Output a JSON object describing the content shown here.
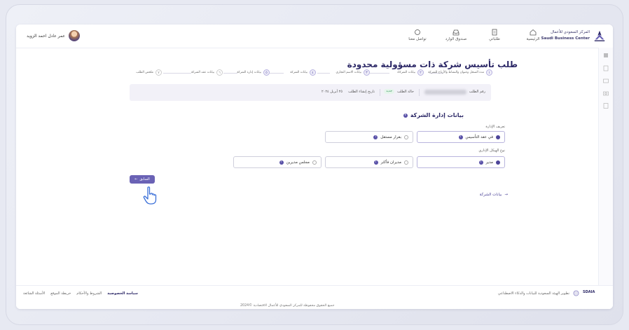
{
  "header": {
    "logo_ar": "المركز السعودي للأعمال",
    "logo_en": "Saudi Business Center",
    "nav": [
      {
        "label": "الرئيسية",
        "icon": "home-icon"
      },
      {
        "label": "طلباتي",
        "icon": "document-icon"
      },
      {
        "label": "صندوق الوارد",
        "icon": "inbox-icon"
      },
      {
        "label": "تواصل معنا",
        "icon": "chat-icon"
      }
    ],
    "user_name": "عمر عادل احمد الزويد"
  },
  "page_title": "طلب تأسيس شركة ذات مسؤولية محدودة",
  "steps": [
    {
      "num": "١",
      "label": "مدة السجل وعنوان والنشاط والأرباح للشركة",
      "state": "done"
    },
    {
      "num": "٢",
      "label": "بيانات الشركاء",
      "state": "done"
    },
    {
      "num": "٣",
      "label": "بيانات الاسم التجاري",
      "state": "done"
    },
    {
      "num": "٤",
      "label": "بيانات الشركة",
      "state": "done"
    },
    {
      "num": "٥",
      "label": "بيانات إدارة الشركة",
      "state": "done"
    },
    {
      "num": "٦",
      "label": "بيانات عقد الشركة",
      "state": "todo"
    },
    {
      "num": "٧",
      "label": "ملخص الطلب",
      "state": "todo"
    }
  ],
  "info_bar": {
    "request_number_label": "رقم الطلب",
    "status_label": "حالة الطلب",
    "status_value": "جديد",
    "created_label": "تاريخ إنشاء الطلب",
    "created_value": "٢٥ أبريل ٢٠٢٤"
  },
  "section": {
    "title": "بيانات إدارة الشركة",
    "management_def_label": "تعريف الإدارة",
    "management_def_options": [
      {
        "label": "في عقد التأسيس",
        "selected": true
      },
      {
        "label": "بقرار مستقل",
        "selected": false
      }
    ],
    "structure_label": "نوع الهيكل الإداري",
    "structure_options": [
      {
        "label": "مدير",
        "selected": true
      },
      {
        "label": "مديران فأكثر",
        "selected": false
      },
      {
        "label": "مجلس مديرين",
        "selected": false
      }
    ]
  },
  "actions": {
    "previous": "السابق",
    "next": "بيانات الشركة"
  },
  "footer": {
    "links": [
      "سياسة الخصوصية",
      "الشروط والأحكام",
      "خريطة الموقع",
      "الأسئلة الشائعة"
    ],
    "sdaia_text": "تطوير الهيئة السعودية للبيانات والذكاء الاصطناعي",
    "sdaia_logo": "SDAIA",
    "copyright": "جميع الحقوق محفوظة للمركز السعودي للأعمال الاقتصادية ©2024"
  },
  "colors": {
    "brand": "#2b2766",
    "accent": "#6a62b5",
    "radio_on": "#4d4599"
  }
}
